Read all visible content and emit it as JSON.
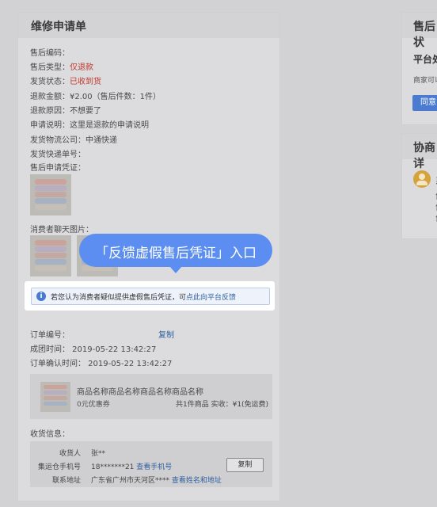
{
  "left_card": {
    "title": "维修申请单",
    "rows": [
      {
        "label": "售后编码：",
        "value": ""
      },
      {
        "label": "售后类型：",
        "value": "仅退款"
      },
      {
        "label": "发货状态：",
        "value": "已收到货"
      },
      {
        "label": "退款金额：",
        "value": "¥2.00（售后件数：1件）"
      },
      {
        "label": "退款原因：",
        "value": "不想要了"
      },
      {
        "label": "申请说明：",
        "value": "这里是退款的申请说明"
      },
      {
        "label": "发货物流公司：",
        "value": "中通快递"
      },
      {
        "label": "发货快递单号：",
        "value": ""
      }
    ],
    "evidence_label": "售后申请凭证：",
    "chat_images_label": "消费者聊天图片：",
    "notice": {
      "text": "若您认为消费者疑似提供虚假售后凭证，可",
      "link": "点此向平台反馈"
    },
    "order": {
      "order_no_label": "订单编号：",
      "copy_label": "复制",
      "group_time": "成团时间：  2019-05-22 13:42:27",
      "confirm_time": "订单确认时间：  2019-05-22 13:42:27"
    },
    "product": {
      "name": "商品名称商品名称商品名称商品名称",
      "coupon": "0元优惠券",
      "summary": "共1件商品   实收：¥1(免运费)"
    },
    "receiver": {
      "section_label": "收货信息：",
      "name_label": "收货人",
      "name_value": "张**",
      "phone_label": "集运仓手机号",
      "phone_value": "18*******21",
      "phone_link": "查看手机号",
      "address_label": "联系地址",
      "address_value": "广东省广州市天河区****",
      "address_link": "查看姓名和地址",
      "copy_button": "复制"
    }
  },
  "callout": {
    "text": "「反馈虚假售后凭证」入口"
  },
  "right_panel": {
    "card1_title": "售后状",
    "platform_label": "平台处",
    "merchant_text": "商家可以",
    "agree_button": "同意",
    "card2_title": "协商详",
    "avatar_fragment": "系",
    "side_fragments": [
      "售",
      "售",
      "售"
    ]
  },
  "colors": {
    "accent_blue": "#5b8ef0",
    "status_red": "#c0392b",
    "link_blue": "#2f5f9e"
  }
}
